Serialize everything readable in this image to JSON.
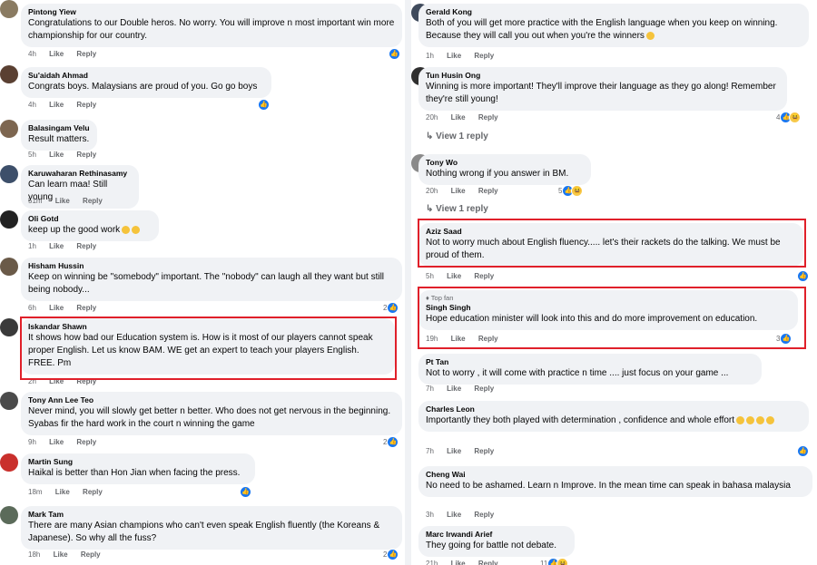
{
  "labels": {
    "like": "Like",
    "reply": "Reply",
    "view_1_reply": "View 1 reply",
    "top_fan": "Top fan"
  },
  "left": [
    {
      "author": "Pintong Yiew",
      "text": "Congratulations to our Double heros. No worry. You will improve n most important win more championship for our country.",
      "time": "4h",
      "reactions": ""
    },
    {
      "author": "Su'aidah Ahmad",
      "text": "Congrats boys. Malaysians are proud of you. Go go boys",
      "time": "4h",
      "reactions": ""
    },
    {
      "author": "Balasingam Velu",
      "text": "Result matters.",
      "time": "5h"
    },
    {
      "author": "Karuwaharan Rethinasamy",
      "text": "Can learn maa! Still young",
      "time": "51m"
    },
    {
      "author": "Oli Gotd",
      "text": "keep up the good work",
      "time": "1h"
    },
    {
      "author": "Hisham Hussin",
      "text": "Keep on winning be \"somebody\" important. The \"nobody\" can laugh all they want but still being nobody...",
      "time": "6h",
      "reactions": "2"
    },
    {
      "author": "Iskandar Shawn",
      "text": "It shows how bad our Education system is. How is it most of our players cannot speak proper English. Let us know BAM. WE get an expert to teach your players English. FREE. Pm",
      "time": "2h"
    },
    {
      "author": "Tony Ann Lee Teo",
      "text": "Never mind, you will slowly get better n better. Who does not get nervous in the beginning. Syabas fir the hard work in the court n winning the game",
      "time": "9h",
      "reactions": "2"
    },
    {
      "author": "Martin Sung",
      "text": "Haikal is better than Hon Jian when facing the press.",
      "time": "18m"
    },
    {
      "author": "Mark Tam",
      "text": "There are many Asian champions who can't even speak English fluently (the Koreans & Japanese). So why all the fuss?",
      "time": "18h",
      "reactions": "2"
    }
  ],
  "right": [
    {
      "author": "Gerald Kong",
      "text": "Both of you will get more practice with the English language when you keep on winning. Because they will call you out when you're the winners",
      "time": "1h"
    },
    {
      "author": "Tun Husin Ong",
      "text": "Winning is more important! They'll improve their language as they go along! Remember they're still young!",
      "time": "20h",
      "reactions": "4"
    },
    {
      "author": "Tony Wo",
      "text": "Nothing wrong if you answer in BM.",
      "time": "20h",
      "reactions": "5"
    },
    {
      "author": "Aziz Saad",
      "text": "Not to worry much about English fluency..... let's their rackets do the talking. We must be proud of them.",
      "time": "5h"
    },
    {
      "author": "Singh Singh",
      "text": "Hope education minister will look into this and do more improvement on education.",
      "time": "19h",
      "reactions": "3"
    },
    {
      "author": "Pt Tan",
      "text": "Not to worry , it will come with practice n time .... just focus on your game ...",
      "time": "7h"
    },
    {
      "author": "Charles Leon",
      "text": "Importantly they both played with determination , confidence and whole effort",
      "time": "7h"
    },
    {
      "author": "Cheng Wai",
      "text": "No need to be ashamed. Learn n Improve. In the mean time can speak in bahasa malaysia",
      "time": "3h"
    },
    {
      "author": "Marc Irwandi Arief",
      "text": "They going for battle not debate.",
      "time": "21h",
      "reactions": "11"
    }
  ],
  "colors": {
    "bubble": "#f0f2f5",
    "highlight": "#e0202a",
    "like_blue": "#1877f2",
    "meta_gray": "#65676b"
  }
}
